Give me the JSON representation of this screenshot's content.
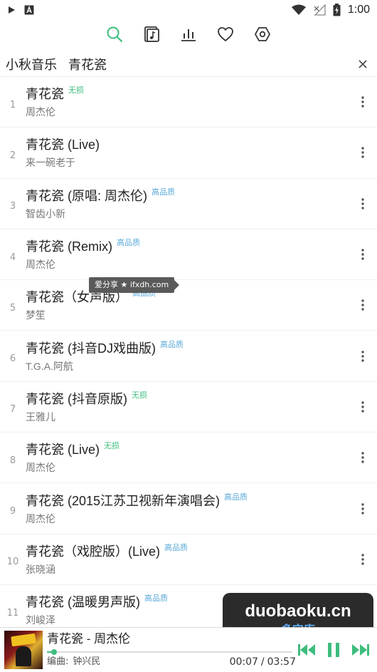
{
  "status_bar": {
    "time": "1:00",
    "icons": [
      "play-icon",
      "a-notification-icon",
      "wifi-icon",
      "signal-icon",
      "battery-icon"
    ]
  },
  "nav": {
    "tabs": [
      {
        "name": "search-icon",
        "active": true
      },
      {
        "name": "music-file-icon",
        "active": false
      },
      {
        "name": "chart-icon",
        "active": false
      },
      {
        "name": "heart-icon",
        "active": false
      },
      {
        "name": "settings-icon",
        "active": false
      }
    ],
    "accent": "#3dbd7d",
    "icon_color": "#333333"
  },
  "header": {
    "app_name": "小秋音乐",
    "query": "青花瓷",
    "close_icon": "close-icon"
  },
  "songs": [
    {
      "index": "1",
      "title": "青花瓷",
      "artist": "周杰伦",
      "quality": "无损",
      "quality_type": "lossless"
    },
    {
      "index": "2",
      "title": "青花瓷 (Live)",
      "artist": "来一碗老于",
      "quality": "",
      "quality_type": ""
    },
    {
      "index": "3",
      "title": "青花瓷 (原唱: 周杰伦)",
      "artist": "智齿小新",
      "quality": "高品质",
      "quality_type": "hq"
    },
    {
      "index": "4",
      "title": "青花瓷 (Remix)",
      "artist": "周杰伦",
      "quality": "高品质",
      "quality_type": "hq"
    },
    {
      "index": "5",
      "title": "青花瓷（女声版）",
      "artist": "梦笙",
      "quality": "高品质",
      "quality_type": "hq"
    },
    {
      "index": "6",
      "title": "青花瓷 (抖音DJ戏曲版)",
      "artist": "T.G.A.阿航",
      "quality": "高品质",
      "quality_type": "hq"
    },
    {
      "index": "7",
      "title": "青花瓷 (抖音原版)",
      "artist": "王雅儿",
      "quality": "无损",
      "quality_type": "lossless"
    },
    {
      "index": "8",
      "title": "青花瓷 (Live)",
      "artist": "周杰伦",
      "quality": "无损",
      "quality_type": "lossless"
    },
    {
      "index": "9",
      "title": "青花瓷 (2015江苏卫视新年演唱会)",
      "artist": "周杰伦",
      "quality": "高品质",
      "quality_type": "hq"
    },
    {
      "index": "10",
      "title": "青花瓷（戏腔版）(Live)",
      "artist": "张晓涵",
      "quality": "高品质",
      "quality_type": "hq"
    },
    {
      "index": "11",
      "title": "青花瓷 (温暖男声版)",
      "artist": "刘峻泽",
      "quality": "高品质",
      "quality_type": "hq"
    }
  ],
  "quality_colors": {
    "lossless": "#3dbd7d",
    "hq": "#5aa9d8"
  },
  "watermarks": {
    "tag": "爱分享 ★ ifxdh.com",
    "box_en": "duobaoku.cn",
    "box_cn": "多宝库"
  },
  "player": {
    "title": "青花瓷 - 周杰伦",
    "composer_label": "编曲:",
    "composer": "钟兴民",
    "time_current": "00:07",
    "time_separator": "/",
    "time_total": "03:57",
    "progress_fraction": 0.03,
    "controls": [
      "previous-icon",
      "pause-icon",
      "next-icon"
    ]
  }
}
